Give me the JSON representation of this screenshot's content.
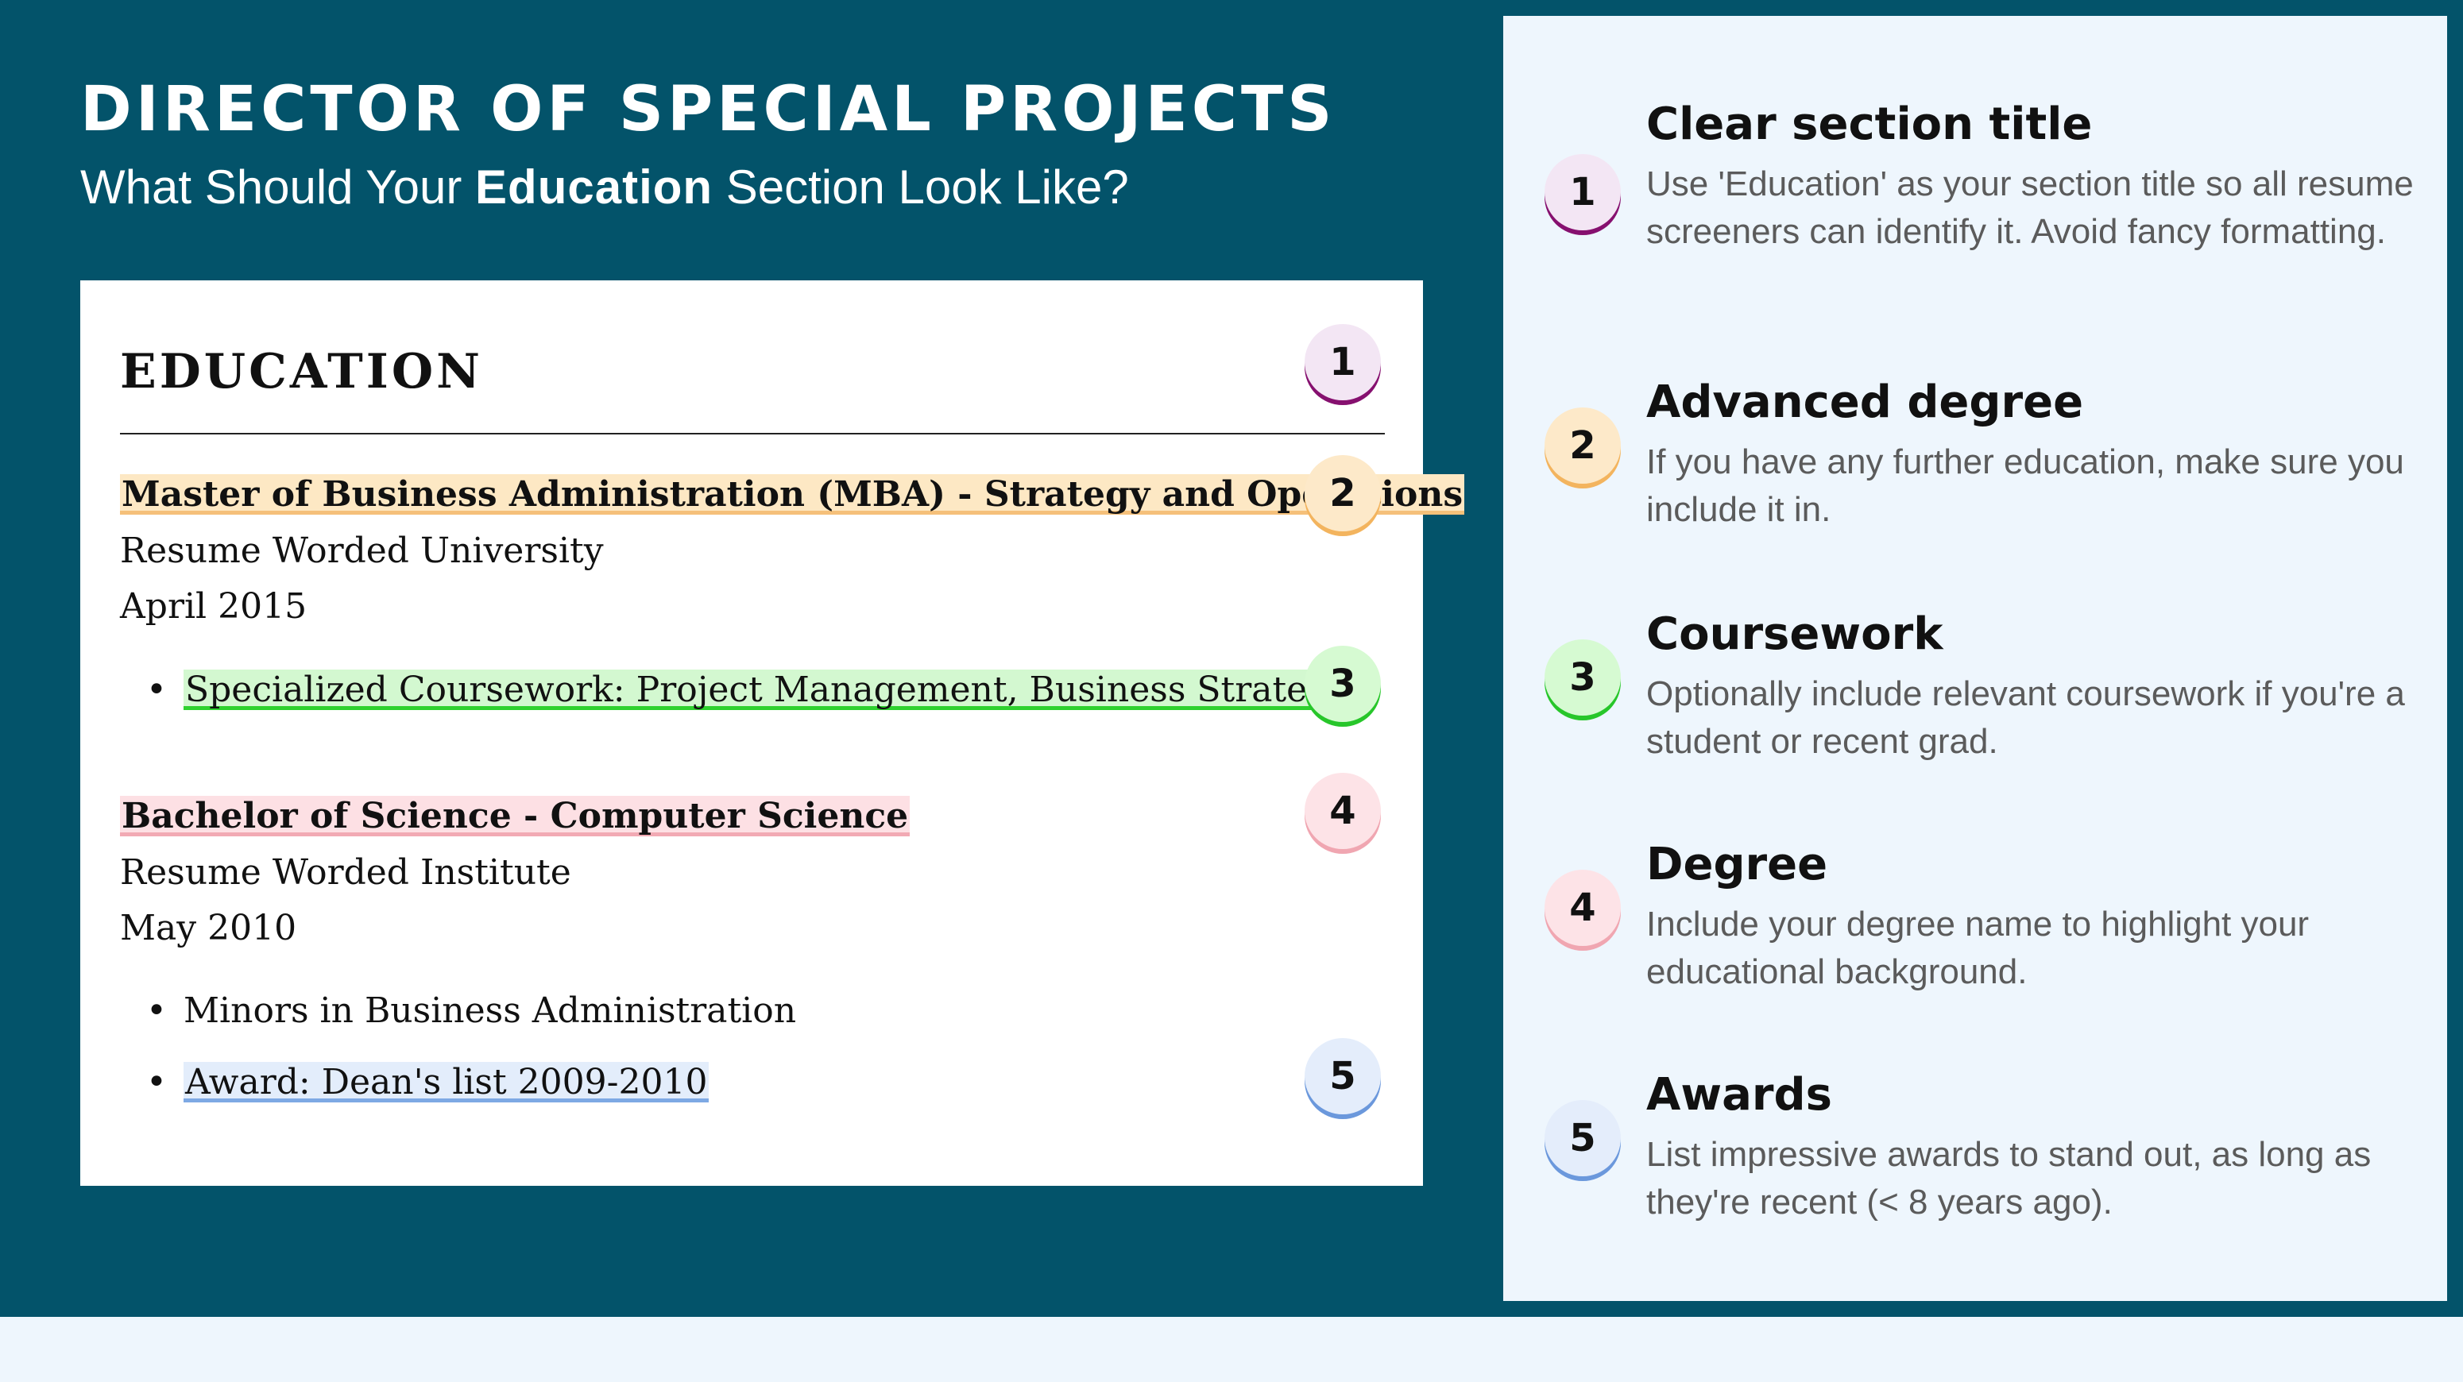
{
  "header": {
    "title": "DIRECTOR OF SPECIAL PROJECTS",
    "subtitle_before": "What Should Your ",
    "subtitle_bold": "Education",
    "subtitle_after": " Section Look Like?"
  },
  "resume": {
    "section_title": "EDUCATION",
    "entries": [
      {
        "degree": "Master of Business Administration (MBA) - Strategy and Operations",
        "school": "Resume Worded University",
        "date": "April 2015",
        "bullets": [
          "Specialized Coursework: Project Management, Business Strategy"
        ]
      },
      {
        "degree": "Bachelor of Science - Computer Science",
        "school": "Resume Worded Institute",
        "date": "May 2010",
        "bullets": [
          "Minors in Business Administration",
          "Award: Dean's list 2009-2010"
        ]
      }
    ]
  },
  "badges": [
    "1",
    "2",
    "3",
    "4",
    "5"
  ],
  "tips": [
    {
      "number": "1",
      "title": "Clear section title",
      "description": "Use 'Education' as your section title so all resume screeners can identify it. Avoid fancy formatting.",
      "color": "#86106f"
    },
    {
      "number": "2",
      "title": "Advanced degree",
      "description": "If you have any further education, make sure you include it in.",
      "color": "#f3b45e"
    },
    {
      "number": "3",
      "title": "Coursework",
      "description": "Optionally include relevant coursework if you're a student or recent grad.",
      "color": "#27c62a"
    },
    {
      "number": "4",
      "title": "Degree",
      "description": "Include your degree name to highlight your educational background.",
      "color": "#f0a6b1"
    },
    {
      "number": "5",
      "title": "Awards",
      "description": "List impressive awards to stand out, as long as they're recent (< 8 years ago).",
      "color": "#6b98dc"
    }
  ],
  "colors": {
    "banner": "#03536a",
    "panel": "#eef6fd"
  }
}
